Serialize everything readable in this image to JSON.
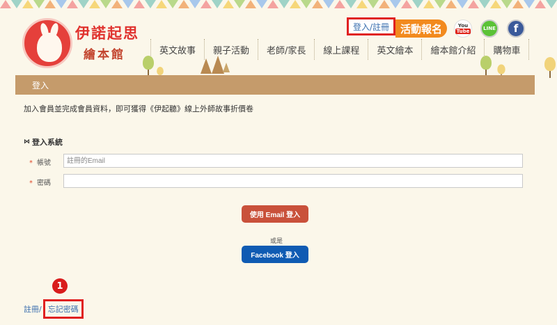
{
  "logo": {
    "title": "伊諾起思",
    "subtitle": "繪本館"
  },
  "header": {
    "login_register": "登入/註冊",
    "event_signup": "活動報名",
    "youtube": {
      "top": "You",
      "bottom": "Tube"
    },
    "line": "LINE",
    "facebook": "f"
  },
  "nav": {
    "items": [
      {
        "label": "英文故事"
      },
      {
        "label": "親子活動"
      },
      {
        "label": "老師/家長"
      },
      {
        "label": "線上課程"
      },
      {
        "label": "英文繪本"
      },
      {
        "label": "繪本館介紹"
      },
      {
        "label": "購物車"
      }
    ]
  },
  "breadcrumb": "登入",
  "promo_text": "加入會員並完成會員資料，即可獲得《伊起聽》線上外師故事折價卷",
  "login": {
    "section_title": "登入系統",
    "account_label": "帳號",
    "account_placeholder": "註冊的Email",
    "password_label": "密碼",
    "password_value": "",
    "email_button": "使用 Email 登入",
    "or_text": "或是",
    "facebook_button": "Facebook 登入"
  },
  "footer": {
    "register_link": "註冊",
    "separator": "/",
    "forgot_link": "忘記密碼",
    "step_badge": "1"
  },
  "colors": {
    "crumb_bar": "#c59b6b",
    "email_button": "#c9513b",
    "facebook_button": "#0f5bb3",
    "highlight": "#e02020",
    "event_badge": "#f28a1e"
  }
}
